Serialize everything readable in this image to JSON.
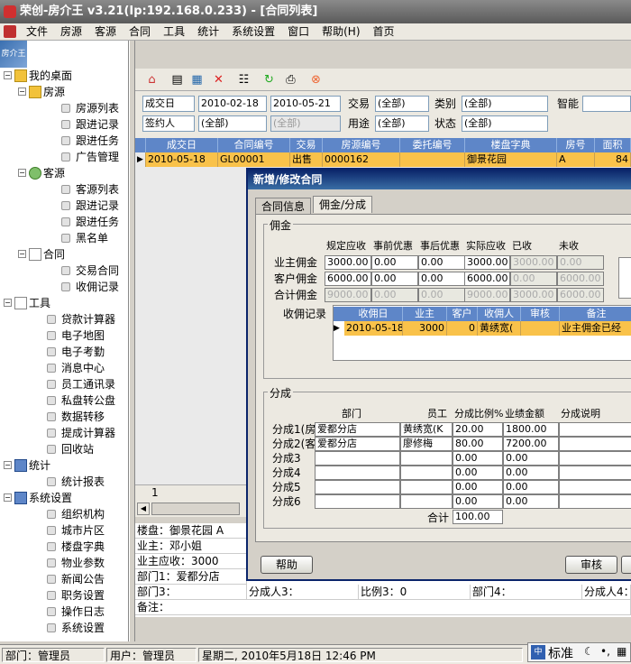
{
  "window": {
    "title": "荣创-房介王 v3.21(Ip:192.168.0.233) - [合同列表]"
  },
  "menu": [
    "文件",
    "房源",
    "客源",
    "合同",
    "工具",
    "统计",
    "系统设置",
    "窗口",
    "帮助(H)",
    "首页"
  ],
  "sidebar": {
    "corner_label": "房介王",
    "items": [
      {
        "label": "我的桌面",
        "level": 0,
        "toggle": "−",
        "icon": "desktop-icon"
      },
      {
        "label": "房源",
        "level": 1,
        "toggle": "−",
        "icon": "house-icon"
      },
      {
        "label": "房源列表",
        "level": 2,
        "icon": "doc-icon"
      },
      {
        "label": "跟进记录",
        "level": 2,
        "icon": "doc-icon"
      },
      {
        "label": "跟进任务",
        "level": 2,
        "icon": "doc-icon"
      },
      {
        "label": "广告管理",
        "level": 2,
        "icon": "doc-icon"
      },
      {
        "label": "客源",
        "level": 1,
        "toggle": "−",
        "icon": "customer-icon"
      },
      {
        "label": "客源列表",
        "level": 2,
        "icon": "doc-icon"
      },
      {
        "label": "跟进记录",
        "level": 2,
        "icon": "doc-icon"
      },
      {
        "label": "跟进任务",
        "level": 2,
        "icon": "doc-icon"
      },
      {
        "label": "黑名单",
        "level": 2,
        "icon": "doc-icon"
      },
      {
        "label": "合同",
        "level": 1,
        "toggle": "−",
        "icon": "contract-icon"
      },
      {
        "label": "交易合同",
        "level": 2,
        "icon": "doc-icon"
      },
      {
        "label": "收佣记录",
        "level": 2,
        "icon": "doc-icon"
      },
      {
        "label": "工具",
        "level": 0,
        "toggle": "−",
        "icon": "tools-icon"
      },
      {
        "label": "贷款计算器",
        "level": 1,
        "icon": "doc-icon"
      },
      {
        "label": "电子地图",
        "level": 1,
        "icon": "doc-icon"
      },
      {
        "label": "电子考勤",
        "level": 1,
        "icon": "doc-icon"
      },
      {
        "label": "消息中心",
        "level": 1,
        "icon": "doc-icon"
      },
      {
        "label": "员工通讯录",
        "level": 1,
        "icon": "doc-icon"
      },
      {
        "label": "私盘转公盘",
        "level": 1,
        "icon": "doc-icon"
      },
      {
        "label": "数据转移",
        "level": 1,
        "icon": "doc-icon"
      },
      {
        "label": "提成计算器",
        "level": 1,
        "icon": "doc-icon"
      },
      {
        "label": "回收站",
        "level": 1,
        "icon": "doc-icon"
      },
      {
        "label": "统计",
        "level": 0,
        "toggle": "−",
        "icon": "stats-icon"
      },
      {
        "label": "统计报表",
        "level": 1,
        "icon": "doc-icon"
      },
      {
        "label": "系统设置",
        "level": 0,
        "toggle": "−",
        "icon": "settings-icon"
      },
      {
        "label": "组织机构",
        "level": 1,
        "icon": "doc-icon"
      },
      {
        "label": "城市片区",
        "level": 1,
        "icon": "doc-icon"
      },
      {
        "label": "楼盘字典",
        "level": 1,
        "icon": "doc-icon"
      },
      {
        "label": "物业参数",
        "level": 1,
        "icon": "doc-icon"
      },
      {
        "label": "新闻公告",
        "level": 1,
        "icon": "doc-icon"
      },
      {
        "label": "职务设置",
        "level": 1,
        "icon": "doc-icon"
      },
      {
        "label": "操作日志",
        "level": 1,
        "icon": "doc-icon"
      },
      {
        "label": "系统设置",
        "level": 1,
        "icon": "doc-icon"
      }
    ]
  },
  "filters": {
    "date_label": "成交日",
    "date_from": "2010-02-18",
    "date_to": "2010-05-21",
    "deal_label": "交易",
    "deal_value": "(全部)",
    "category_label": "类别",
    "category_value": "(全部)",
    "smart_label": "智能",
    "signer_label": "签约人",
    "signer_value": "(全部)",
    "signer_sub": "(全部)",
    "use_label": "用途",
    "use_value": "(全部)",
    "state_label": "状态",
    "state_value": "(全部)"
  },
  "grid": {
    "columns": [
      "成交日",
      "合同编号",
      "交易",
      "房源编号",
      "委托编号",
      "楼盘字典",
      "房号",
      "面积"
    ],
    "rows": [
      [
        "2010-05-18",
        "GL00001",
        "出售",
        "0000162",
        "",
        "御景花园",
        "A",
        "84"
      ]
    ],
    "pager": "1"
  },
  "detail": {
    "rows": [
      [
        "楼盘：御景花园 A"
      ],
      [
        "业主：邓小姐"
      ],
      [
        "业主应收：3000"
      ],
      [
        "部门1：爱都分店"
      ],
      [
        "部门3：",
        "分成人3：",
        "比例3：0",
        "部门4：",
        "分成人4："
      ],
      [
        "备注："
      ]
    ]
  },
  "dialog": {
    "title": "新增/修改合同",
    "tabs": [
      "合同信息",
      "佣金/分成"
    ],
    "commission": {
      "group_label": "佣金",
      "headers": [
        "规定应收",
        "事前优惠",
        "事后优惠",
        "实际应收",
        "已收",
        "未收"
      ],
      "rows": [
        {
          "label": "业主佣金",
          "values": [
            "3000.00",
            "0.00",
            "0.00",
            "3000.00",
            "3000.00",
            "0.00"
          ]
        },
        {
          "label": "客户佣金",
          "values": [
            "6000.00",
            "0.00",
            "0.00",
            "6000.00",
            "0.00",
            "6000.00"
          ]
        },
        {
          "label": "合计佣金",
          "values": [
            "9000.00",
            "0.00",
            "0.00",
            "9000.00",
            "3000.00",
            "6000.00"
          ]
        }
      ],
      "record_label": "收佣记录",
      "record_headers": [
        "收佣日",
        "业主",
        "客户",
        "收佣人",
        "审核",
        "备注"
      ],
      "record_rows": [
        [
          "2010-05-18",
          "3000",
          "0",
          "黄绣宽(",
          "",
          "业主佣金已经"
        ]
      ]
    },
    "split": {
      "group_label": "分成",
      "headers": [
        "部门",
        "员工",
        "分成比例%",
        "业绩金额",
        "分成说明"
      ],
      "rows": [
        {
          "label": "分成1(房)",
          "dept": "爱都分店",
          "staff": "黄绣宽(K",
          "ratio": "20.00",
          "amount": "1800.00"
        },
        {
          "label": "分成2(客)",
          "dept": "爱都分店",
          "staff": "廖修梅",
          "ratio": "80.00",
          "amount": "7200.00"
        },
        {
          "label": "分成3",
          "dept": "",
          "staff": "",
          "ratio": "0.00",
          "amount": "0.00"
        },
        {
          "label": "分成4",
          "dept": "",
          "staff": "",
          "ratio": "0.00",
          "amount": "0.00"
        },
        {
          "label": "分成5",
          "dept": "",
          "staff": "",
          "ratio": "0.00",
          "amount": "0.00"
        },
        {
          "label": "分成6",
          "dept": "",
          "staff": "",
          "ratio": "0.00",
          "amount": "0.00"
        }
      ],
      "total_label": "合计",
      "total_value": "100.00"
    },
    "help_button": "帮助",
    "audit_button": "审核"
  },
  "status": {
    "dept": "部门：管理员",
    "user": "用户：管理员",
    "time": "星期二, 2010年5月18日 12:46 PM",
    "ime": "标准"
  },
  "colors": {
    "selection": "#f9c24a",
    "header": "#5e86c8",
    "dialog_title": "#0a246a"
  }
}
